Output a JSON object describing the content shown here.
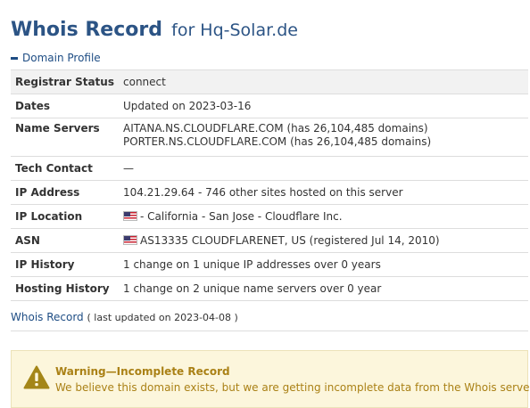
{
  "header": {
    "title": "Whois Record",
    "subtitle": "for Hq-Solar.de"
  },
  "section": {
    "label": "Domain Profile"
  },
  "profile": {
    "registrar_status": {
      "label": "Registrar Status",
      "value": "connect"
    },
    "dates": {
      "label": "Dates",
      "value": "Updated on 2023-03-16"
    },
    "name_servers": {
      "label": "Name Servers",
      "lines": [
        "AITANA.NS.CLOUDFLARE.COM (has 26,104,485 domains)",
        "PORTER.NS.CLOUDFLARE.COM (has 26,104,485 domains)"
      ]
    },
    "tech_contact": {
      "label": "Tech Contact",
      "value": "—"
    },
    "ip_address": {
      "label": "IP Address",
      "value": "104.21.29.64 - 746 other sites hosted on this server"
    },
    "ip_location": {
      "label": "IP Location",
      "value": "- California - San Jose - Cloudflare Inc.",
      "flag_icon": "us-flag-icon"
    },
    "asn": {
      "label": "ASN",
      "value": "AS13335 CLOUDFLARENET, US (registered Jul 14, 2010)",
      "flag_icon": "us-flag-icon"
    },
    "ip_history": {
      "label": "IP History",
      "value": "1 change on 1 unique IP addresses over 0 years"
    },
    "hosting_history": {
      "label": "Hosting History",
      "value": "1 change on 2 unique name servers over 0 year"
    }
  },
  "footer": {
    "link": "Whois Record",
    "updated": "( last updated on 2023-04-08 )"
  },
  "warning": {
    "icon": "warning-triangle-icon",
    "title": "Warning—Incomplete Record",
    "text": "We believe this domain exists, but we are getting incomplete data from the Whois server."
  },
  "colors": {
    "title": "#2c5485",
    "link": "#1e4d84",
    "warning_background": "#fcf6dc",
    "warning_text": "#aa8116"
  }
}
